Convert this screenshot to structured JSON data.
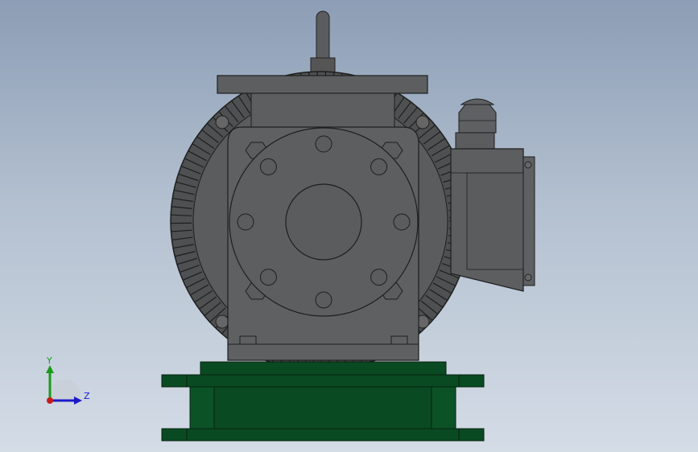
{
  "viewport": {
    "background_top": "#8c9db5",
    "background_bottom": "#d4dce6"
  },
  "model": {
    "body_color": "#5c5e60",
    "edge_color": "#1e1e1e",
    "base_color": "#0a4a22"
  },
  "triad": {
    "y_label": "Y",
    "z_label": "Z",
    "y_color": "#1a9a1a",
    "z_color": "#1a1ac8",
    "x_color": "#c81a1a"
  }
}
